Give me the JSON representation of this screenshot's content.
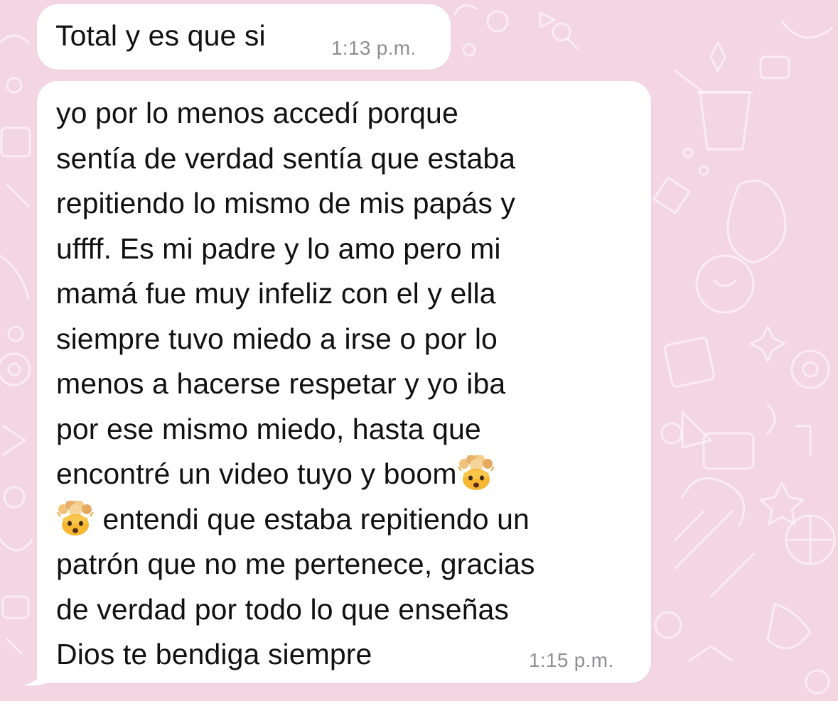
{
  "colors": {
    "wallpaper": "#f3d6e2",
    "bubble": "#ffffff",
    "text": "#111111",
    "timestamp": "#8e8e93"
  },
  "messages": [
    {
      "lines": [
        "Total y es que si"
      ],
      "time": "1:13 p.m."
    },
    {
      "lines": [
        "yo por lo menos accedí porque",
        "sentía de verdad sentía que estaba",
        "repitiendo lo mismo de mis papás y",
        "uffff. Es mi padre y lo amo pero mi",
        "mamá fue muy infeliz con el y ella",
        "siempre tuvo miedo a irse o por lo",
        "menos a hacerse respetar y yo iba",
        "por ese mismo miedo, hasta que",
        "encontré un video tuyo y boom",
        " entendi que estaba repitiendo un",
        "patrón que no me pertenece, gracias",
        "de verdad por todo lo que enseñas",
        "Dios te bendiga siempre"
      ],
      "emoji_icon": "exploding-head-emoji",
      "time": "1:15 p.m."
    }
  ]
}
